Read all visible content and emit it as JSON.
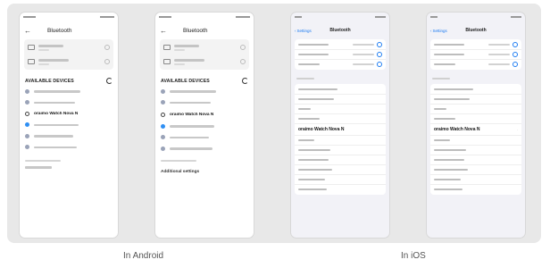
{
  "captions": {
    "android": "In Android",
    "ios": "In iOS"
  },
  "android": {
    "title": "Bluetooth",
    "available_heading": "AVAILABLE DEVICES",
    "highlight_device": "oraimo Watch Nova N",
    "additional_settings": "Additional settings"
  },
  "ios": {
    "back_label": "Settings",
    "title": "Bluetooth",
    "highlight_device": "oraimo Watch Nova N"
  },
  "colors": {
    "accent_blue": "#2f8ff3",
    "ios_blue": "#1e7cf2"
  }
}
